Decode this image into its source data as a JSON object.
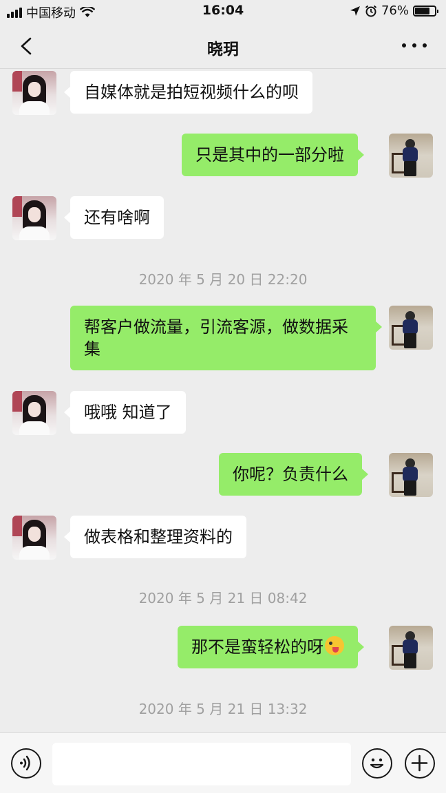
{
  "status_bar": {
    "carrier": "中国移动",
    "time": "16:04",
    "battery": "76%",
    "battery_level": 0.76,
    "icons": [
      "signal-icon",
      "wifi-icon",
      "location-icon",
      "alarm-icon",
      "battery-icon"
    ]
  },
  "nav": {
    "title": "晓玥",
    "back_icon": "chevron-left-icon",
    "more_icon": "more-icon"
  },
  "messages": [
    {
      "side": "in",
      "text": "自媒体就是拍短视频什么的呗"
    },
    {
      "side": "out",
      "text": "只是其中的一部分啦"
    },
    {
      "side": "in",
      "text": "还有啥啊"
    },
    {
      "side": "out",
      "text": "帮客户做流量，引流客源，做数据采集"
    },
    {
      "side": "in",
      "text": "哦哦 知道了"
    },
    {
      "side": "out",
      "text": "你呢？负责什么"
    },
    {
      "side": "in",
      "text": "做表格和整理资料的"
    },
    {
      "side": "out",
      "text": "那不是蛮轻松的呀",
      "emoji": "winking-tongue-emoji"
    }
  ],
  "timestamps": [
    "2020 年 5 月 20 日 22:20",
    "2020 年 5 月 21 日 08:42",
    "2020 年 5 月 21 日 13:32"
  ],
  "input_bar": {
    "voice_icon": "voice-icon",
    "emoji_icon": "emoji-icon",
    "plus_icon": "plus-icon",
    "placeholder": ""
  },
  "colors": {
    "background": "#ededed",
    "outgoing_bubble": "#95ec69",
    "incoming_bubble": "#ffffff",
    "timestamp_text": "#a0a0a0"
  }
}
